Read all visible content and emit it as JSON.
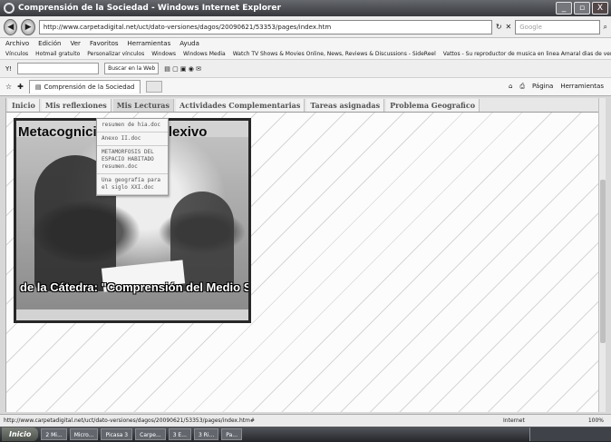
{
  "window": {
    "title": "Comprensión de la Sociedad - Windows Internet Explorer",
    "minimize": "_",
    "maximize": "▫",
    "close": "X"
  },
  "address": {
    "url": "http://www.carpetadigital.net/uct/dato-versiones/dagos/20090621/53353/pages/index.htm",
    "search_placeholder": "Google"
  },
  "menu": [
    "Archivo",
    "Edición",
    "Ver",
    "Favoritos",
    "Herramientas",
    "Ayuda"
  ],
  "favorites": {
    "label": "Vínculos",
    "items": [
      "Hotmail gratuito",
      "Personalizar vínculos",
      "Windows",
      "Windows Media",
      "Watch TV Shows & Movies Online, News, Reviews & Discussions - SideReel",
      "Vattos - Su reproductor de musica en linea Amaral dias de verano"
    ]
  },
  "toolbar": {
    "search_button": "Buscar en la Web"
  },
  "tab": {
    "label": "Comprensión de la Sociedad",
    "page_menu": "Página",
    "tools_menu": "Herramientas"
  },
  "site_nav": [
    "Inicio",
    "Mis reflexiones",
    "Mis Lecturas",
    "Actividades Complementarias",
    "Tareas asignadas",
    "Problema Geografico"
  ],
  "dropdown": [
    "resumen de hia.doc",
    "Anexo II.doc",
    "METAMORFOSIS DEL ESPACIO HABITADO resumen.doc",
    "Una geografía para el siglo XXI.doc"
  ],
  "banner": {
    "title_top": "Metacognición  …  o- reflexivo",
    "title_bottom": "de la Cátedra: \"Comprensión del Medio Social\""
  },
  "status": {
    "url": "http://www.carpetadigital.net/uct/dato-versiones/dagos/20090621/53353/pages/index.htm#",
    "zone": "Internet",
    "zoom": "100%"
  },
  "taskbar": {
    "start": "Inicio",
    "items": [
      "2 Mi...",
      "Micro...",
      "Picasa 3",
      "Carpe...",
      "3 E...",
      "3 Ri...",
      "Pa..."
    ]
  }
}
